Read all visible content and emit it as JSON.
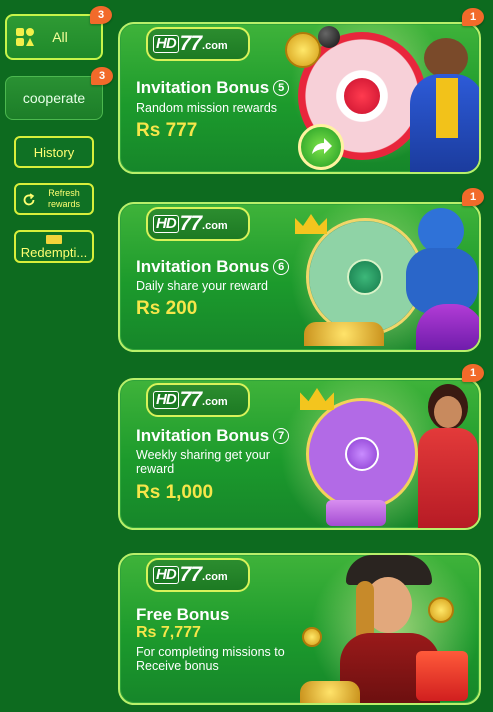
{
  "sidebar": {
    "categories": [
      {
        "label": "All",
        "badge": "3"
      },
      {
        "label": "cooperate",
        "badge": "3"
      }
    ],
    "history_label": "History",
    "refresh_label": "Refresh rewards",
    "redeem_label": "Redempti..."
  },
  "cards": [
    {
      "logo": {
        "hd": "HD",
        "num": "77",
        "com": ".com"
      },
      "title": "Invitation Bonus",
      "index": "5",
      "subtitle": "Random mission rewards",
      "amount": "Rs 777",
      "badge": "1"
    },
    {
      "logo": {
        "hd": "HD",
        "num": "77",
        "com": ".com"
      },
      "title": "Invitation Bonus",
      "index": "6",
      "subtitle": "Daily share your reward",
      "amount": "Rs 200",
      "badge": "1"
    },
    {
      "logo": {
        "hd": "HD",
        "num": "77",
        "com": ".com"
      },
      "title": "Invitation Bonus",
      "index": "7",
      "subtitle": "Weekly sharing get your reward",
      "amount": "Rs 1,000",
      "badge": "1"
    },
    {
      "logo": {
        "hd": "HD",
        "num": "77",
        "com": ".com"
      },
      "title": "Free Bonus",
      "amount": "Rs 7,777",
      "subtitle": "For completing missions to Receive bonus"
    }
  ],
  "colors": {
    "background": "#0d6b1f",
    "accent_yellow": "#f6e64a",
    "badge_orange": "#f26a2a",
    "border_lime": "#d8ef3b"
  }
}
